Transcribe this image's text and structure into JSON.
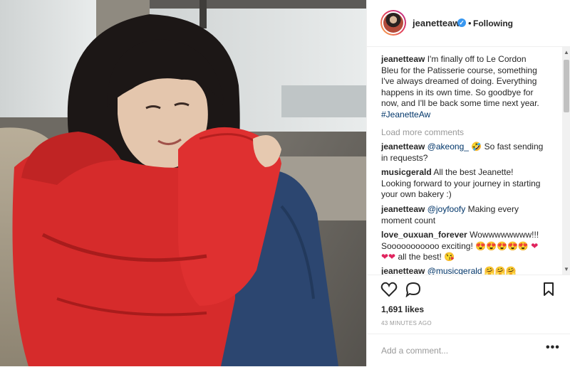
{
  "post": {
    "username": "jeanetteaw",
    "verified_icon": "verified-badge-icon",
    "follow_separator": "•",
    "follow_status": "Following"
  },
  "caption": {
    "username": "jeanetteaw",
    "text": "I'm finally off to Le Cordon Bleu for the Patisserie course, something I've always dreamed of doing. Everything happens in its own time. So goodbye for now, and I'll be back some time next year.",
    "hashtag": "#JeanetteAw"
  },
  "load_more": "Load more comments",
  "comments": [
    {
      "username": "jeanetteaw",
      "mention": "@akeong_",
      "emoji": "🤣",
      "text": "So fast sending in requests?"
    },
    {
      "username": "musicgerald",
      "text": "All the best Jeanette! Looking forward to your journey in starting your own bakery :)"
    },
    {
      "username": "jeanetteaw",
      "mention": "@joyfoofy",
      "text": "Making every moment count"
    },
    {
      "username": "love_ouxuan_forever",
      "text": "Wowwwwwwww!!! Sooooooooooo exciting!",
      "emojis_1": "😍😍😍😍😍",
      "hearts": "❤❤❤",
      "text2": "all the best!",
      "emoji_end": "😘"
    },
    {
      "username": "jeanetteaw",
      "mention": "@musicgerald",
      "emojis": "🤗🤗🤗"
    }
  ],
  "actions": {
    "like_icon": "heart-outline-icon",
    "comment_icon": "comment-bubble-icon",
    "save_icon": "bookmark-icon"
  },
  "likes": "1,691 likes",
  "timestamp": "43 MINUTES AGO",
  "add_comment": {
    "placeholder": "Add a comment...",
    "more": "•••"
  },
  "colors": {
    "accent_blue": "#3897f0",
    "hashtag": "#003569",
    "muted": "#999999",
    "jacket_red": "#d62b2b",
    "jeans_blue": "#2c4670"
  }
}
